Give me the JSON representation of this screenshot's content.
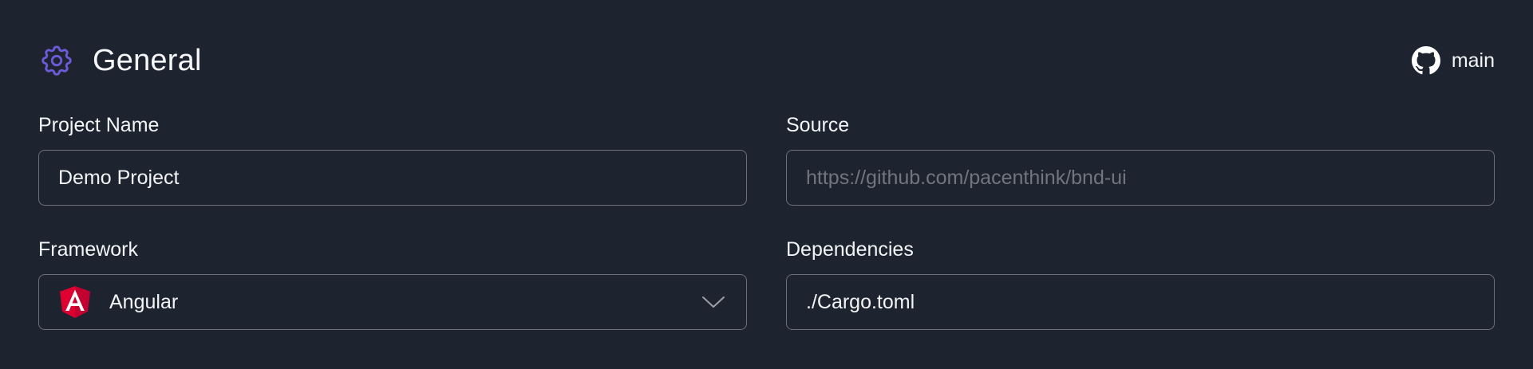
{
  "header": {
    "title": "General",
    "icon": "gear-icon",
    "branch": {
      "icon": "github-icon",
      "label": "main"
    }
  },
  "fields": {
    "project_name": {
      "label": "Project Name",
      "value": "Demo Project"
    },
    "source": {
      "label": "Source",
      "value": "",
      "placeholder": "https://github.com/pacenthink/bnd-ui"
    },
    "framework": {
      "label": "Framework",
      "selected": "Angular",
      "icon": "angular-icon"
    },
    "dependencies": {
      "label": "Dependencies",
      "value": "./Cargo.toml"
    }
  },
  "colors": {
    "background": "#1e2330",
    "accent": "#6b5bd6",
    "border": "#6b7078",
    "angular_red": "#dd0031"
  }
}
